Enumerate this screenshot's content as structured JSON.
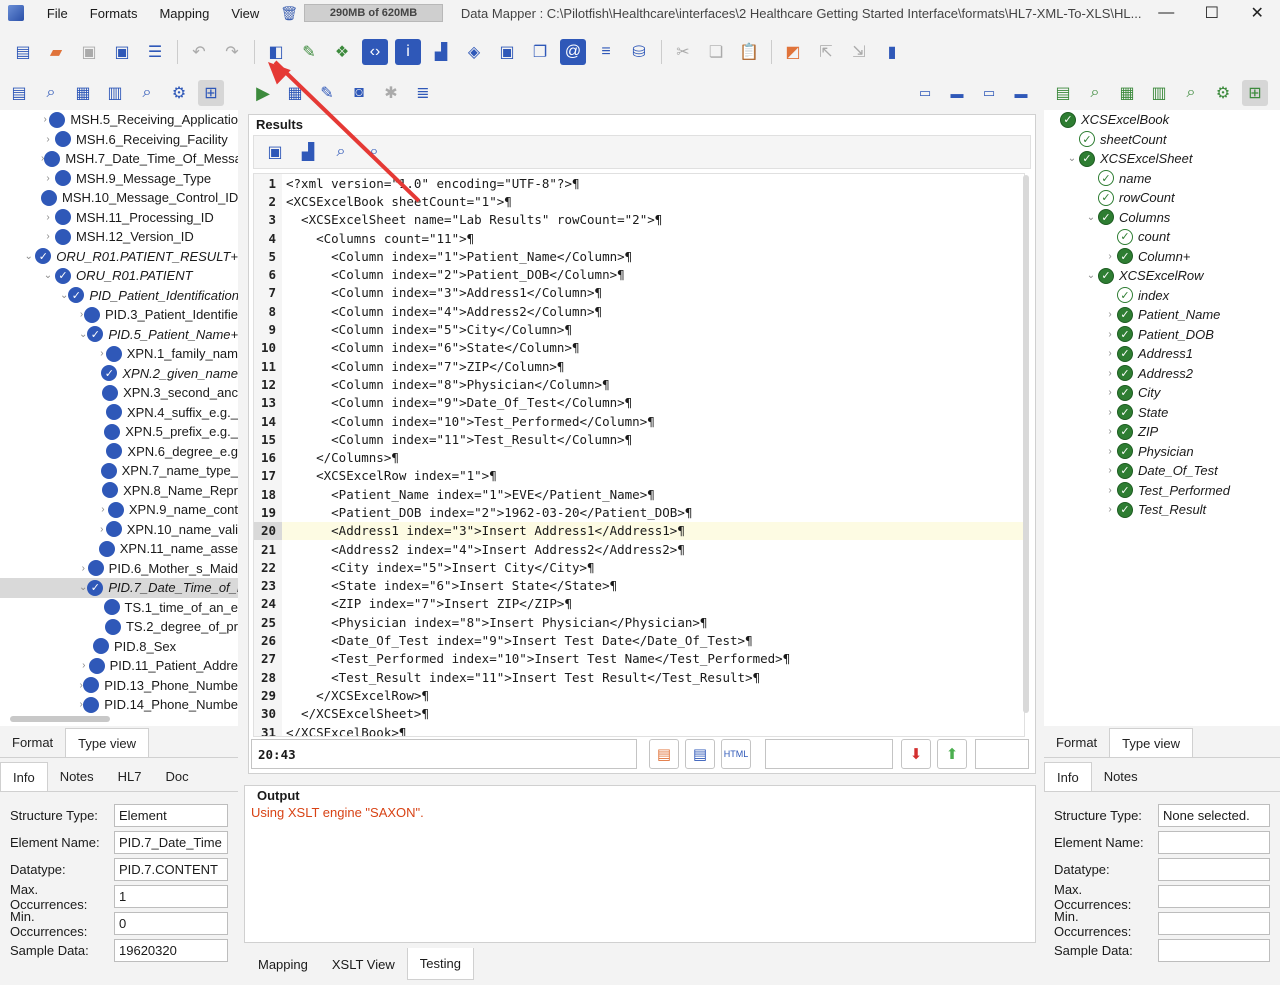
{
  "menu": [
    "File",
    "Formats",
    "Mapping",
    "View"
  ],
  "memory": "290MB of 620MB",
  "window_title": "Data Mapper : C:\\Pilotfish\\Healthcare\\interfaces\\2 Healthcare Getting Started Interface\\formats\\HL7-XML-To-XLS\\HL...",
  "window_controls": [
    "minimize-icon",
    "maximize-icon",
    "close-icon"
  ],
  "left_tree": [
    {
      "indent": 1,
      "tw": "›",
      "icon": "blue",
      "label": "MSH.5_Receiving_Applicatio",
      "italic": false
    },
    {
      "indent": 1,
      "tw": "›",
      "icon": "blue",
      "label": "MSH.6_Receiving_Facility",
      "italic": false
    },
    {
      "indent": 1,
      "tw": "›",
      "icon": "blue",
      "label": "MSH.7_Date_Time_Of_Messa",
      "italic": false
    },
    {
      "indent": 1,
      "tw": "›",
      "icon": "blue",
      "label": "MSH.9_Message_Type",
      "italic": false
    },
    {
      "indent": 1,
      "tw": "",
      "icon": "blue",
      "label": "MSH.10_Message_Control_ID",
      "italic": false
    },
    {
      "indent": 1,
      "tw": "›",
      "icon": "blue",
      "label": "MSH.11_Processing_ID",
      "italic": false
    },
    {
      "indent": 1,
      "tw": "›",
      "icon": "blue",
      "label": "MSH.12_Version_ID",
      "italic": false
    },
    {
      "indent": 0,
      "tw": "⌄",
      "icon": "check",
      "label": "ORU_R01.PATIENT_RESULT+",
      "italic": true
    },
    {
      "indent": 1,
      "tw": "⌄",
      "icon": "check",
      "label": "ORU_R01.PATIENT",
      "italic": true
    },
    {
      "indent": 2,
      "tw": "⌄",
      "icon": "check",
      "label": "PID_Patient_Identification",
      "italic": true
    },
    {
      "indent": 3,
      "tw": "›",
      "icon": "blue",
      "label": "PID.3_Patient_Identifie",
      "italic": false
    },
    {
      "indent": 3,
      "tw": "⌄",
      "icon": "check",
      "label": "PID.5_Patient_Name+",
      "italic": true
    },
    {
      "indent": 4,
      "tw": "›",
      "icon": "blue",
      "label": "XPN.1_family_nam",
      "italic": false
    },
    {
      "indent": 4,
      "tw": "",
      "icon": "check",
      "label": "XPN.2_given_name",
      "italic": true
    },
    {
      "indent": 4,
      "tw": "",
      "icon": "blue",
      "label": "XPN.3_second_anc",
      "italic": false
    },
    {
      "indent": 4,
      "tw": "",
      "icon": "blue",
      "label": "XPN.4_suffix_e.g._",
      "italic": false
    },
    {
      "indent": 4,
      "tw": "",
      "icon": "blue",
      "label": "XPN.5_prefix_e.g._",
      "italic": false
    },
    {
      "indent": 4,
      "tw": "",
      "icon": "blue",
      "label": "XPN.6_degree_e.g",
      "italic": false
    },
    {
      "indent": 4,
      "tw": "",
      "icon": "blue",
      "label": "XPN.7_name_type_",
      "italic": false
    },
    {
      "indent": 4,
      "tw": "",
      "icon": "blue",
      "label": "XPN.8_Name_Repr",
      "italic": false
    },
    {
      "indent": 4,
      "tw": "›",
      "icon": "blue",
      "label": "XPN.9_name_cont",
      "italic": false
    },
    {
      "indent": 4,
      "tw": "›",
      "icon": "blue",
      "label": "XPN.10_name_vali",
      "italic": false
    },
    {
      "indent": 4,
      "tw": "",
      "icon": "blue",
      "label": "XPN.11_name_asse",
      "italic": false
    },
    {
      "indent": 3,
      "tw": "›",
      "icon": "blue",
      "label": "PID.6_Mother_s_Maid",
      "italic": false
    },
    {
      "indent": 3,
      "tw": "⌄",
      "icon": "check",
      "label": "PID.7_Date_Time_of_B",
      "italic": true,
      "selected": true
    },
    {
      "indent": 4,
      "tw": "",
      "icon": "blue",
      "label": "TS.1_time_of_an_e",
      "italic": false
    },
    {
      "indent": 4,
      "tw": "",
      "icon": "blue",
      "label": "TS.2_degree_of_pr",
      "italic": false
    },
    {
      "indent": 3,
      "tw": "",
      "icon": "blue",
      "label": "PID.8_Sex",
      "italic": false
    },
    {
      "indent": 3,
      "tw": "›",
      "icon": "blue",
      "label": "PID.11_Patient_Addre",
      "italic": false
    },
    {
      "indent": 3,
      "tw": "›",
      "icon": "blue",
      "label": "PID.13_Phone_Numbe",
      "italic": false
    },
    {
      "indent": 3,
      "tw": "›",
      "icon": "blue",
      "label": "PID.14_Phone_Numbe",
      "italic": false
    }
  ],
  "left_bottom": {
    "tabs": [
      "Format",
      "Type view"
    ],
    "subtabs": [
      "Info",
      "Notes",
      "HL7",
      "Doc"
    ],
    "props": [
      {
        "label": "Structure Type:",
        "value": "Element"
      },
      {
        "label": "Element Name:",
        "value": "PID.7_Date_Time"
      },
      {
        "label": "Datatype:",
        "value": "PID.7.CONTENT"
      },
      {
        "label": "Max. Occurrences:",
        "value": "1"
      },
      {
        "label": "Min. Occurrences:",
        "value": "0"
      },
      {
        "label": "Sample Data:",
        "value": "19620320"
      }
    ]
  },
  "results": {
    "title": "Results",
    "lines": [
      "<?xml version=\"1.0\" encoding=\"UTF-8\"?>¶",
      "<XCSExcelBook sheetCount=\"1\">¶",
      "  <XCSExcelSheet name=\"Lab Results\" rowCount=\"2\">¶",
      "    <Columns count=\"11\">¶",
      "      <Column index=\"1\">Patient_Name</Column>¶",
      "      <Column index=\"2\">Patient_DOB</Column>¶",
      "      <Column index=\"3\">Address1</Column>¶",
      "      <Column index=\"4\">Address2</Column>¶",
      "      <Column index=\"5\">City</Column>¶",
      "      <Column index=\"6\">State</Column>¶",
      "      <Column index=\"7\">ZIP</Column>¶",
      "      <Column index=\"8\">Physician</Column>¶",
      "      <Column index=\"9\">Date_Of_Test</Column>¶",
      "      <Column index=\"10\">Test_Performed</Column>¶",
      "      <Column index=\"11\">Test_Result</Column>¶",
      "    </Columns>¶",
      "    <XCSExcelRow index=\"1\">¶",
      "      <Patient_Name index=\"1\">EVE</Patient_Name>¶",
      "      <Patient_DOB index=\"2\">1962-03-20</Patient_DOB>¶",
      "      <Address1 index=\"3\">Insert Address1</Address1>¶",
      "      <Address2 index=\"4\">Insert Address2</Address2>¶",
      "      <City index=\"5\">Insert City</City>¶",
      "      <State index=\"6\">Insert State</State>¶",
      "      <ZIP index=\"7\">Insert ZIP</ZIP>¶",
      "      <Physician index=\"8\">Insert Physician</Physician>¶",
      "      <Date_Of_Test index=\"9\">Insert Test Date</Date_Of_Test>¶",
      "      <Test_Performed index=\"10\">Insert Test Name</Test_Performed>¶",
      "      <Test_Result index=\"11\">Insert Test Result</Test_Result>¶",
      "    </XCSExcelRow>¶",
      "  </XCSExcelSheet>¶",
      "</XCSExcelBook>¶"
    ],
    "highlight_line": 20,
    "cursor": "20:43"
  },
  "output": {
    "title": "Output",
    "text": "Using XSLT engine \"SAXON\"."
  },
  "bottom_tabs": [
    "Mapping",
    "XSLT View",
    "Testing"
  ],
  "right_tree": [
    {
      "indent": 0,
      "tw": "",
      "icon": "green",
      "label": "XCSExcelBook"
    },
    {
      "indent": 1,
      "tw": "",
      "icon": "outline",
      "label": "sheetCount"
    },
    {
      "indent": 1,
      "tw": "⌄",
      "icon": "green",
      "label": "XCSExcelSheet"
    },
    {
      "indent": 2,
      "tw": "",
      "icon": "outline",
      "label": "name"
    },
    {
      "indent": 2,
      "tw": "",
      "icon": "outline",
      "label": "rowCount"
    },
    {
      "indent": 2,
      "tw": "⌄",
      "icon": "green",
      "label": "Columns"
    },
    {
      "indent": 3,
      "tw": "",
      "icon": "outline",
      "label": "count"
    },
    {
      "indent": 3,
      "tw": "›",
      "icon": "green",
      "label": "Column+"
    },
    {
      "indent": 2,
      "tw": "⌄",
      "icon": "green",
      "label": "XCSExcelRow"
    },
    {
      "indent": 3,
      "tw": "",
      "icon": "outline",
      "label": "index"
    },
    {
      "indent": 3,
      "tw": "›",
      "icon": "green",
      "label": "Patient_Name"
    },
    {
      "indent": 3,
      "tw": "›",
      "icon": "green",
      "label": "Patient_DOB"
    },
    {
      "indent": 3,
      "tw": "›",
      "icon": "green",
      "label": "Address1"
    },
    {
      "indent": 3,
      "tw": "›",
      "icon": "green",
      "label": "Address2"
    },
    {
      "indent": 3,
      "tw": "›",
      "icon": "green",
      "label": "City"
    },
    {
      "indent": 3,
      "tw": "›",
      "icon": "green",
      "label": "State"
    },
    {
      "indent": 3,
      "tw": "›",
      "icon": "green",
      "label": "ZIP"
    },
    {
      "indent": 3,
      "tw": "›",
      "icon": "green",
      "label": "Physician"
    },
    {
      "indent": 3,
      "tw": "›",
      "icon": "green",
      "label": "Date_Of_Test"
    },
    {
      "indent": 3,
      "tw": "›",
      "icon": "green",
      "label": "Test_Performed"
    },
    {
      "indent": 3,
      "tw": "›",
      "icon": "green",
      "label": "Test_Result"
    }
  ],
  "right_bottom": {
    "tabs": [
      "Format",
      "Type view"
    ],
    "subtabs": [
      "Info",
      "Notes"
    ],
    "props": [
      {
        "label": "Structure Type:",
        "value": "None selected."
      },
      {
        "label": "Element Name:",
        "value": ""
      },
      {
        "label": "Datatype:",
        "value": ""
      },
      {
        "label": "Max. Occurrences:",
        "value": ""
      },
      {
        "label": "Min. Occurrences:",
        "value": ""
      },
      {
        "label": "Sample Data:",
        "value": ""
      }
    ]
  },
  "colors": {
    "accent": "#2f58b8",
    "arrow": "#e53935",
    "output": "#d84315",
    "green": "#2e7d32"
  }
}
